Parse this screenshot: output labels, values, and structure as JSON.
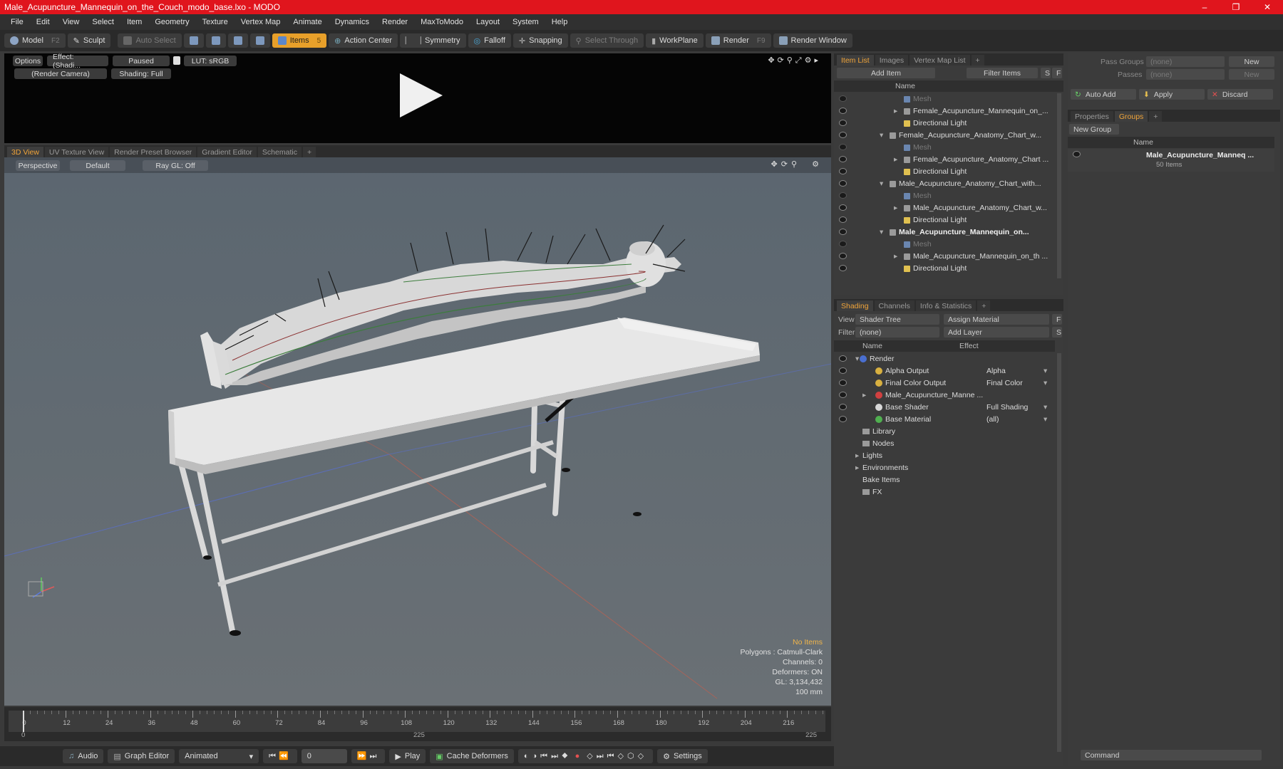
{
  "window": {
    "title": "Male_Acupuncture_Mannequin_on_the_Couch_modo_base.lxo - MODO",
    "controls": [
      "–",
      "❐",
      "✕"
    ]
  },
  "menu": [
    "File",
    "Edit",
    "View",
    "Select",
    "Item",
    "Geometry",
    "Texture",
    "Vertex Map",
    "Animate",
    "Dynamics",
    "Render",
    "MaxToModo",
    "Layout",
    "System",
    "Help"
  ],
  "toolbar": {
    "model": "Model",
    "model_key": "F2",
    "sculpt": "Sculpt",
    "auto_select": "Auto Select",
    "items": "Items",
    "items_key": "5",
    "action_center": "Action Center",
    "symmetry": "Symmetry",
    "falloff": "Falloff",
    "snapping": "Snapping",
    "select_through": "Select Through",
    "workplane": "WorkPlane",
    "render": "Render",
    "render_key": "F9",
    "render_window": "Render Window"
  },
  "preview": {
    "options": "Options",
    "effect": "Effect: (Shadi...",
    "paused": "Paused",
    "lut": "LUT: sRGB",
    "camera": "(Render Camera)",
    "shading": "Shading: Full"
  },
  "viewtabs": [
    "3D View",
    "UV Texture View",
    "Render Preset Browser",
    "Gradient Editor",
    "Schematic",
    "+"
  ],
  "viewport": {
    "perspective": "Perspective",
    "default": "Default",
    "raygl": "Ray GL: Off",
    "info": {
      "no_items": "No Items",
      "polygons": "Polygons : Catmull-Clark",
      "channels": "Channels: 0",
      "deformers": "Deformers: ON",
      "gl": "GL: 3,134,432",
      "scale": "100 mm"
    }
  },
  "timeline": {
    "ticks": [
      "0",
      "12",
      "24",
      "36",
      "48",
      "60",
      "72",
      "84",
      "96",
      "108",
      "120",
      "132",
      "144",
      "156",
      "168",
      "180",
      "192",
      "204",
      "216"
    ],
    "start": "0",
    "mid": "225",
    "end": "225"
  },
  "bottombar": {
    "audio": "Audio",
    "graph_editor": "Graph Editor",
    "animated": "Animated",
    "frame": "0",
    "play": "Play",
    "cache_deformers": "Cache Deformers",
    "settings": "Settings"
  },
  "itemlist": {
    "tabs": [
      "Item List",
      "Images",
      "Vertex Map List",
      "+"
    ],
    "add_item": "Add Item",
    "filter_items": "Filter Items",
    "s": "S",
    "f": "F",
    "col_name": "Name",
    "rows": [
      {
        "label": "Mesh",
        "indent": 3,
        "kind": "mesh",
        "dim": true
      },
      {
        "label": "Female_Acupuncture_Mannequin_on_...",
        "indent": 3,
        "kind": "group"
      },
      {
        "label": "Directional Light",
        "indent": 3,
        "kind": "light"
      },
      {
        "label": "Female_Acupuncture_Anatomy_Chart_w...",
        "indent": 1,
        "kind": "scene"
      },
      {
        "label": "Mesh",
        "indent": 3,
        "kind": "mesh",
        "dim": true
      },
      {
        "label": "Female_Acupuncture_Anatomy_Chart ...",
        "indent": 3,
        "kind": "group"
      },
      {
        "label": "Directional Light",
        "indent": 3,
        "kind": "light"
      },
      {
        "label": "Male_Acupuncture_Anatomy_Chart_with...",
        "indent": 1,
        "kind": "scene"
      },
      {
        "label": "Mesh",
        "indent": 3,
        "kind": "mesh",
        "dim": true
      },
      {
        "label": "Male_Acupuncture_Anatomy_Chart_w...",
        "indent": 3,
        "kind": "group"
      },
      {
        "label": "Directional Light",
        "indent": 3,
        "kind": "light"
      },
      {
        "label": "Male_Acupuncture_Mannequin_on...",
        "indent": 1,
        "kind": "scene",
        "bold": true
      },
      {
        "label": "Mesh",
        "indent": 3,
        "kind": "mesh",
        "dim": true
      },
      {
        "label": "Male_Acupuncture_Mannequin_on_th ...",
        "indent": 3,
        "kind": "group"
      },
      {
        "label": "Directional Light",
        "indent": 3,
        "kind": "light"
      }
    ]
  },
  "shading": {
    "tabs": [
      "Shading",
      "Channels",
      "Info & Statistics",
      "+"
    ],
    "view_label": "View",
    "view_value": "Shader Tree",
    "assign_material": "Assign Material",
    "filter_label": "Filter",
    "filter_value": "(none)",
    "add_layer": "Add Layer",
    "f": "F",
    "s": "S",
    "col_name": "Name",
    "col_effect": "Effect",
    "rows": [
      {
        "label": "Render",
        "effect": "",
        "indent": 0
      },
      {
        "label": "Alpha Output",
        "effect": "Alpha",
        "indent": 1
      },
      {
        "label": "Final Color Output",
        "effect": "Final Color",
        "indent": 1
      },
      {
        "label": "Male_Acupuncture_Manne ...",
        "effect": "",
        "indent": 1
      },
      {
        "label": "Base Shader",
        "effect": "Full Shading",
        "indent": 1
      },
      {
        "label": "Base Material",
        "effect": "(all)",
        "indent": 1
      },
      {
        "label": "Library",
        "effect": "",
        "indent": 0
      },
      {
        "label": "Nodes",
        "effect": "",
        "indent": 0
      },
      {
        "label": "Lights",
        "effect": "",
        "indent": 0
      },
      {
        "label": "Environments",
        "effect": "",
        "indent": 0
      },
      {
        "label": "Bake Items",
        "effect": "",
        "indent": 0
      },
      {
        "label": "FX",
        "effect": "",
        "indent": 0
      }
    ]
  },
  "groups": {
    "pass_groups": "Pass Groups",
    "passes": "Passes",
    "none": "(none)",
    "new": "New",
    "auto_add": "Auto Add",
    "apply": "Apply",
    "discard": "Discard",
    "tabs": [
      "Properties",
      "Groups",
      "+"
    ],
    "new_group": "New Group",
    "col_name": "Name",
    "group_name": "Male_Acupuncture_Manneq ...",
    "group_count": "50 Items"
  },
  "command": {
    "placeholder": "Command"
  },
  "colors": {
    "title_red": "#e0151d",
    "accent": "#f0a43a",
    "active_orange": "#e8a02a"
  }
}
